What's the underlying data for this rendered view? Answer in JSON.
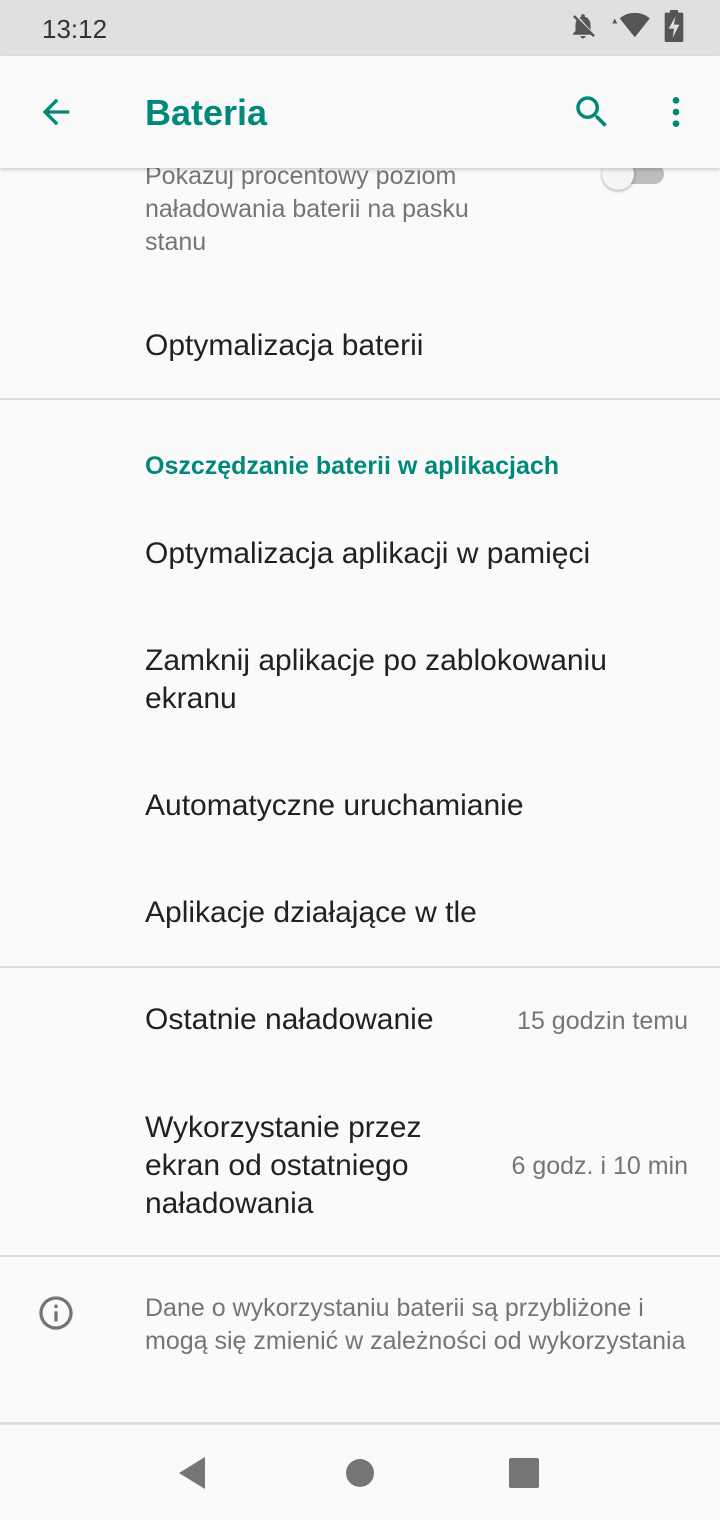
{
  "status_bar": {
    "time": "13:12",
    "icons": [
      "notifications-off-icon",
      "wifi-icon",
      "battery-charging-icon"
    ]
  },
  "app_bar": {
    "title": "Bateria",
    "back_icon": "arrow-back-icon",
    "search_icon": "search-icon",
    "more_icon": "more-vert-icon",
    "accent_color": "#00897b"
  },
  "battery_percentage": {
    "summary": "Pokazuj procentowy poziom naładowania baterii na pasku stanu",
    "enabled": false
  },
  "battery_optimization": {
    "title": "Optymalizacja baterii"
  },
  "app_saving": {
    "header": "Oszczędzanie baterii w aplikacjach",
    "items": [
      {
        "label": "Optymalizacja aplikacji w pamięci"
      },
      {
        "label": "Zamknij aplikacje po zablokowaniu ekranu"
      },
      {
        "label": "Automatyczne uruchamianie"
      },
      {
        "label": "Aplikacje działające w tle"
      }
    ]
  },
  "stats": {
    "last_charge_label": "Ostatnie naładowanie",
    "last_charge_value": "15 godzin temu",
    "screen_usage_label": "Wykorzystanie przez ekran od ostatniego naładowania",
    "screen_usage_value": "6 godz. i 10 min"
  },
  "info": {
    "icon": "info-icon",
    "text": "Dane o wykorzystaniu baterii są przybliżone i mogą się zmienić w zależności od wykorzystania"
  },
  "nav_bar": {
    "back": "nav-back-icon",
    "home": "nav-home-icon",
    "recents": "nav-recents-icon"
  }
}
